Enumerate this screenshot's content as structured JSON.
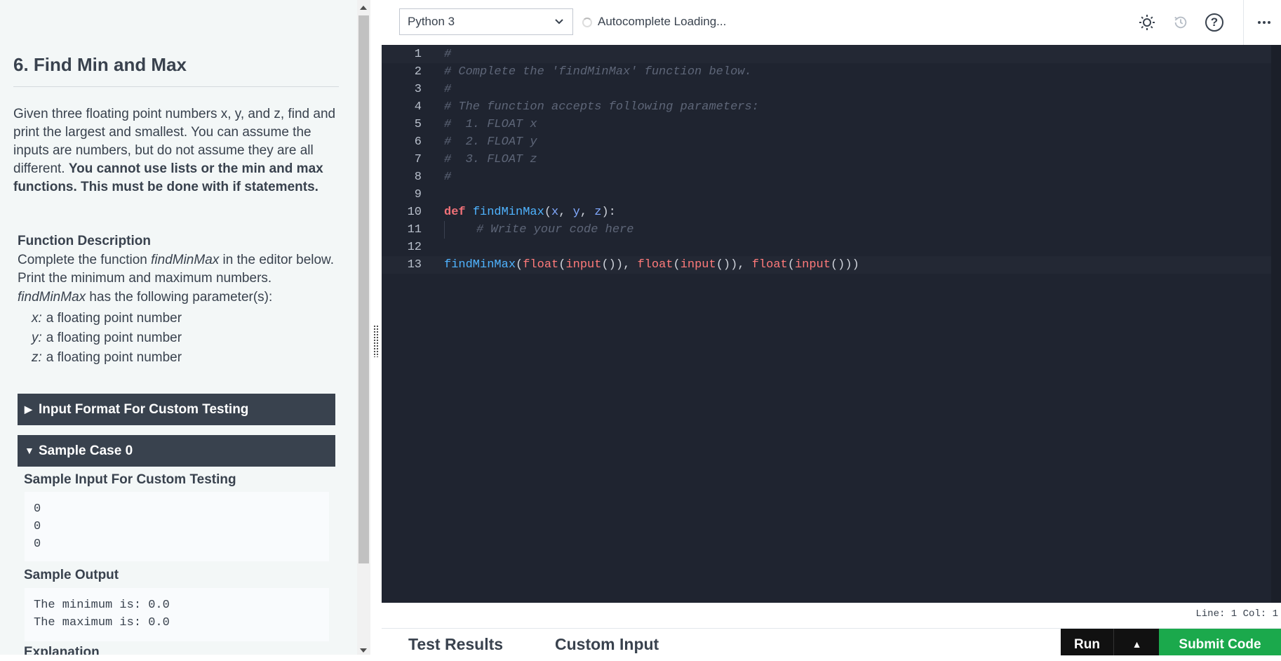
{
  "problem": {
    "title": "6. Find Min and Max",
    "description_plain": "Given three floating point numbers x, y, and z, find and print the largest and smallest. You can assume the inputs are numbers, but do not assume they are all different. ",
    "description_bold": "You cannot use lists or the min and max functions. This must be done with if statements.",
    "function_description": {
      "heading": "Function Description",
      "line1_pre": "Complete the function ",
      "line1_fn": "findMinMax",
      "line1_post": " in the editor below. Print the minimum and maximum numbers.",
      "line2_fn": "findMinMax",
      "line2_post": " has the following parameter(s):",
      "params": [
        {
          "name": "x:",
          "desc": "a floating point number"
        },
        {
          "name": "y:",
          "desc": "a floating point number"
        },
        {
          "name": "z:",
          "desc": "a floating point number"
        }
      ]
    },
    "sections": {
      "input_format": "Input Format For Custom Testing",
      "sample_case": "Sample Case 0"
    },
    "sample": {
      "input_heading": "Sample Input For Custom Testing",
      "input": "0\n0\n0",
      "output_heading": "Sample Output",
      "output": "The minimum is: 0.0\nThe maximum is: 0.0",
      "explanation_heading": "Explanation"
    }
  },
  "editor": {
    "language": "Python 3",
    "autocomplete_status": "Autocomplete Loading...",
    "status_position": "Line: 1 Col: 1",
    "line_numbers": [
      "1",
      "2",
      "3",
      "4",
      "5",
      "6",
      "7",
      "8",
      "9",
      "10",
      "11",
      "12",
      "13"
    ],
    "code": {
      "l1": "#",
      "l2": "# Complete the 'findMinMax' function below.",
      "l3": "#",
      "l4": "# The function accepts following parameters:",
      "l5": "#  1. FLOAT x",
      "l6": "#  2. FLOAT y",
      "l7": "#  3. FLOAT z",
      "l8": "#",
      "l10": {
        "kw": "def",
        "fn": "findMinMax",
        "p1": "x",
        "p2": "y",
        "p3": "z"
      },
      "l11": "# Write your code here",
      "l13": {
        "fn": "findMinMax",
        "b1": "float",
        "b2": "input"
      }
    }
  },
  "bottom": {
    "tab_results": "Test Results",
    "tab_custom": "Custom Input",
    "run_label": "Run",
    "submit_label": "Submit Code"
  },
  "icons": [
    "sun-icon",
    "history-icon",
    "help-icon",
    "more-icon",
    "chevron-down-icon",
    "spinner-icon",
    "caret-right-icon",
    "caret-down-icon",
    "caret-up-icon"
  ],
  "colors": {
    "accent_green": "#1ba94c",
    "editor_bg": "#1f2430",
    "header_dark": "#39424e"
  }
}
